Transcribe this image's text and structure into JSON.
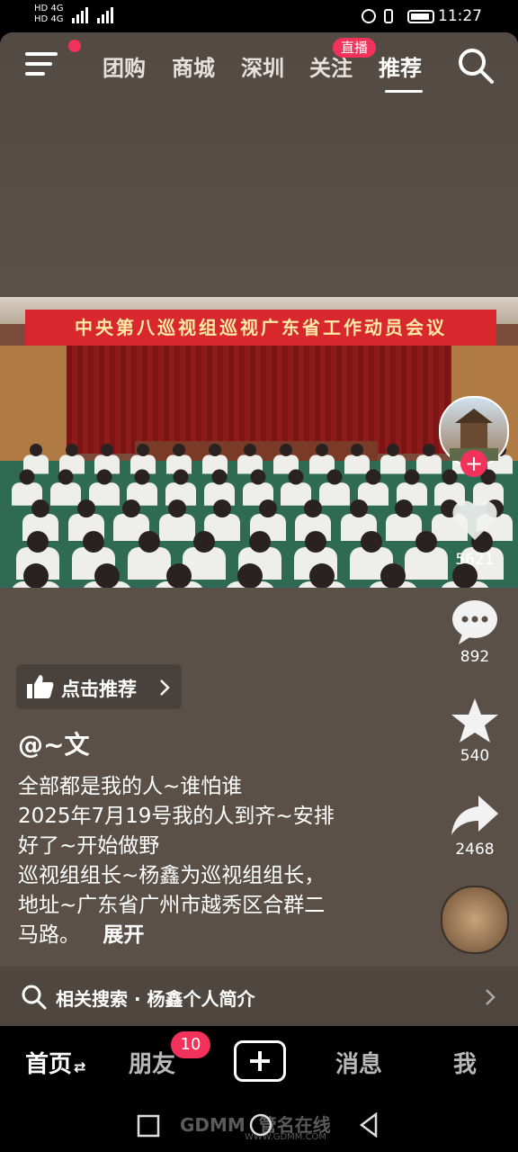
{
  "status_bar": {
    "sim1": "HD 4G",
    "sim2": "HD 4G",
    "time": "11:27"
  },
  "top_nav": {
    "tabs": [
      "团购",
      "商城",
      "深圳",
      "关注",
      "推荐"
    ],
    "active_tab": "推荐",
    "live_badge": "直播"
  },
  "video": {
    "banner_text": "中央第八巡视组巡视广东省工作动员会议"
  },
  "right_rail": {
    "like_count": "5621",
    "comment_count": "892",
    "favorite_count": "540",
    "share_count": "2468"
  },
  "caption": {
    "recommend_chip": "点击推荐",
    "author": "@~文",
    "lines": [
      "全部都是我的人~谁怕谁",
      "2025年7月19号我的人到齐~安排",
      "好了~开始做野",
      "巡视组组长~杨鑫为巡视组组长，",
      "地址~广东省广州市越秀区合群二",
      "马路。"
    ],
    "expand": "展开"
  },
  "related_search": "相关搜索 · 杨鑫个人简介",
  "bottom_tabs": {
    "home": "首页",
    "friends": "朋友",
    "friends_badge": "10",
    "messages": "消息",
    "me": "我"
  },
  "watermark": {
    "brand": "GDMM",
    "name": "管名在线",
    "url": "WWW.GDMM.COM"
  },
  "colors": {
    "accent": "#f2325a",
    "background": "#5a5048"
  }
}
